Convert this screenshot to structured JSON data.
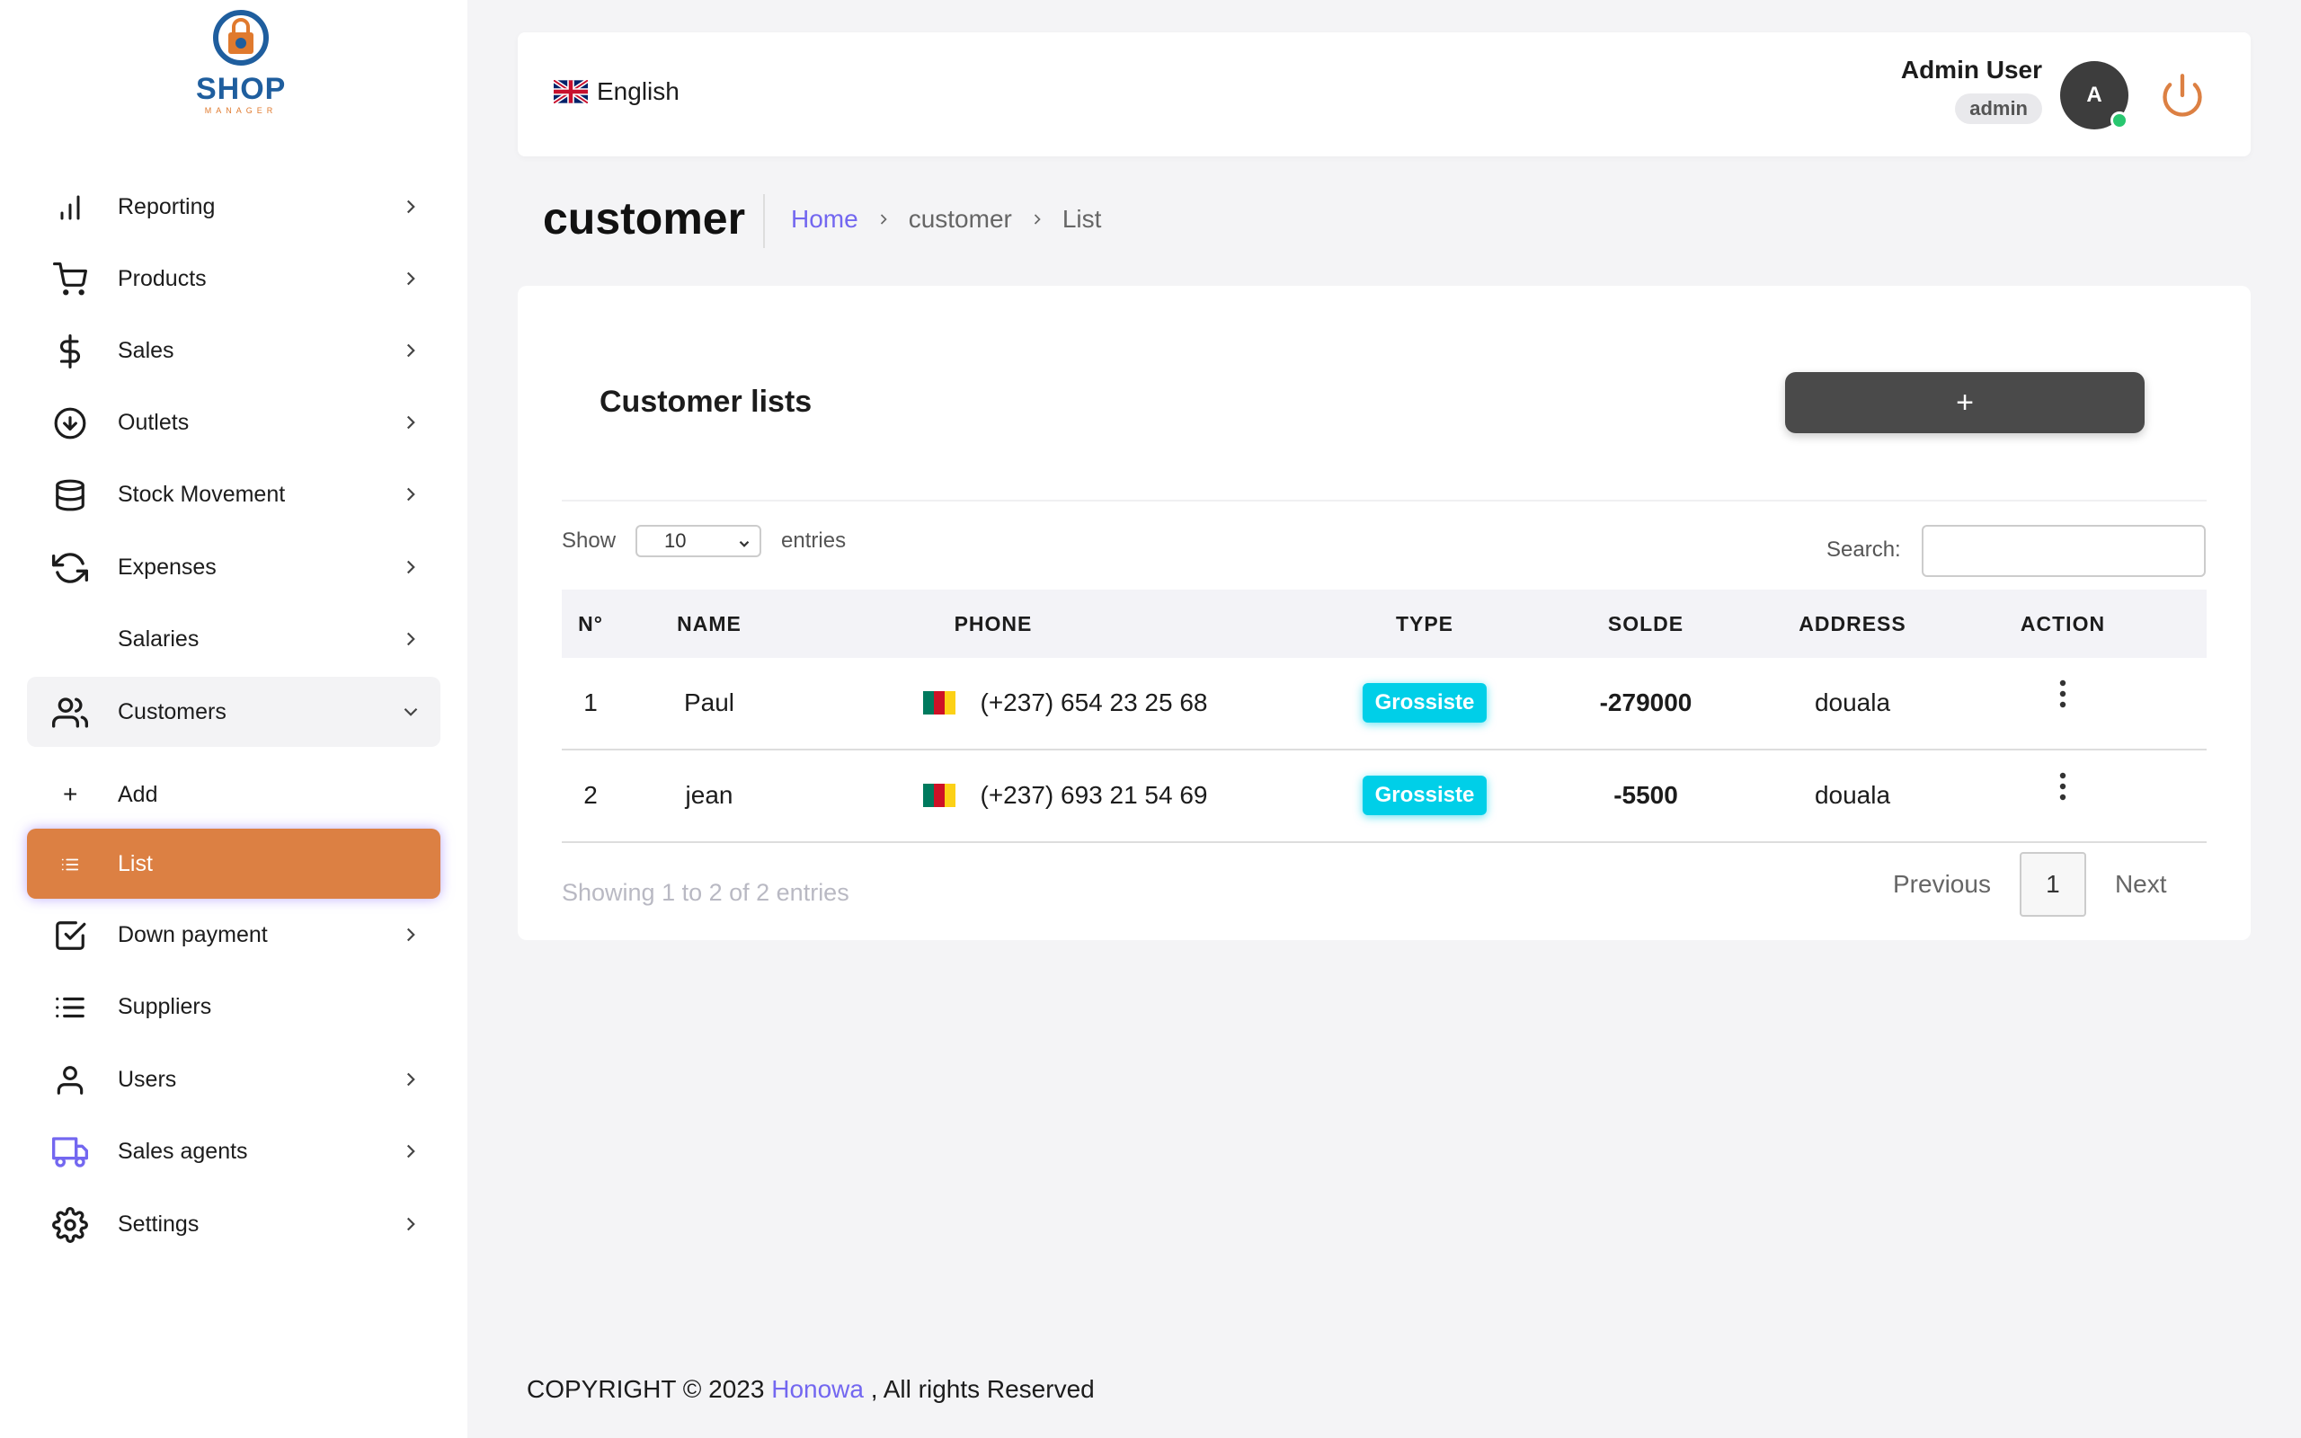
{
  "brand": {
    "logo_text": "SHOP",
    "logo_sub": "MANAGER"
  },
  "sidebar": {
    "items": [
      {
        "label": "Reporting",
        "icon": "bar-chart-icon"
      },
      {
        "label": "Products",
        "icon": "cart-icon"
      },
      {
        "label": "Sales",
        "icon": "dollar-icon"
      },
      {
        "label": "Outlets",
        "icon": "arrow-down-circle-icon"
      },
      {
        "label": "Stock Movement",
        "icon": "database-icon"
      },
      {
        "label": "Expenses",
        "icon": "refresh-icon"
      },
      {
        "label": "Salaries",
        "icon": ""
      },
      {
        "label": "Customers",
        "icon": "users-icon",
        "expanded": true
      },
      {
        "label": "Add",
        "icon": "plus-icon"
      },
      {
        "label": "List",
        "icon": "list-icon",
        "active": true
      },
      {
        "label": "Down payment",
        "icon": "check-square-icon"
      },
      {
        "label": "Suppliers",
        "icon": "list-icon"
      },
      {
        "label": "Users",
        "icon": "user-icon"
      },
      {
        "label": "Sales agents",
        "icon": "truck-icon"
      },
      {
        "label": "Settings",
        "icon": "gear-icon"
      }
    ]
  },
  "header": {
    "language": "English",
    "user_name": "Admin User",
    "user_role": "admin",
    "avatar_initial": "A"
  },
  "page": {
    "title": "customer",
    "breadcrumb": [
      "Home",
      "customer",
      "List"
    ]
  },
  "card": {
    "title": "Customer lists",
    "add_label": "+",
    "show_label": "Show",
    "entries_label": "entries",
    "page_size": "10",
    "search_label": "Search:",
    "search_value": ""
  },
  "table": {
    "columns": [
      "N°",
      "NAME",
      "PHONE",
      "TYPE",
      "SOLDE",
      "ADDRESS",
      "ACTION"
    ],
    "rows": [
      {
        "no": "1",
        "name": "Paul",
        "phone": "(+237) 654 23 25 68",
        "type": "Grossiste",
        "solde": "-279000",
        "address": "douala"
      },
      {
        "no": "2",
        "name": "jean",
        "phone": "(+237) 693 21 54 69",
        "type": "Grossiste",
        "solde": "-5500",
        "address": "douala"
      }
    ]
  },
  "pagination": {
    "info": "Showing 1 to 2 of 2 entries",
    "previous": "Previous",
    "current": "1",
    "next": "Next"
  },
  "footer": {
    "prefix": "COPYRIGHT © 2023",
    "brand": "Honowa",
    "suffix": ", All rights Reserved"
  },
  "colors": {
    "accent": "#dc8043",
    "primary": "#7367f0",
    "badge": "#00cfe8",
    "button": "#4a4a4a"
  }
}
